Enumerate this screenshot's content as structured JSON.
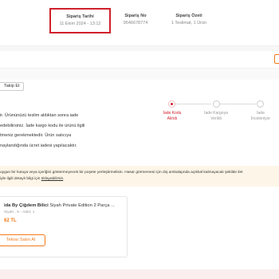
{
  "order_info": {
    "date": {
      "label": "Sipariş Tarihi",
      "value": "11 Ekim 2024 - 13:12"
    },
    "number": {
      "label": "Sipariş No",
      "value": "9546678774"
    },
    "summary": {
      "label": "Sipariş Özeti",
      "value": "1 Teslimat, 1 Ürün"
    }
  },
  "track_button": "Takip Et",
  "description": [
    "ir. Ürününüzü teslim aldıktan sonra iade",
    "edebilirsiniz. İade kargo kodu ile ürünü ilgili",
    "tmeniz gerekmektedir. Ürün satıcıya",
    "naylandığında ücret iadesi yapılacaktır."
  ],
  "return_steps": [
    {
      "line1": "İade Kodu",
      "line2": "Alındı",
      "active": true
    },
    {
      "line1": "İade Kargoya",
      "line2": "Verildi",
      "active": false
    },
    {
      "line1": "İade",
      "line2": "İnceleniyor",
      "active": false
    }
  ],
  "warning": {
    "line1": "uygun bir kutuya veya içeriğini göstermeyecek bir poşete yerleştirmelisin. Hasar görmemesi için dış ambalajında açıkkal kalmayacak şekilde ilet",
    "line2_prefix": "iyle ilgili detaylı bilgi için ",
    "link": "tıklayabilirsin",
    "line2_suffix": "."
  },
  "product": {
    "brand": "ida By Çiğdem Bilici",
    "name": "Siyah Private Edition 2 Parça ...",
    "variant": "Siyah , S - Adet: 1",
    "price": "62 TL",
    "reorder_button": "Tekrar Satın Al"
  },
  "colors": {
    "accent_orange": "#f27a1a",
    "active_red": "#d0202a",
    "warning_bg": "#fdf6e8"
  }
}
